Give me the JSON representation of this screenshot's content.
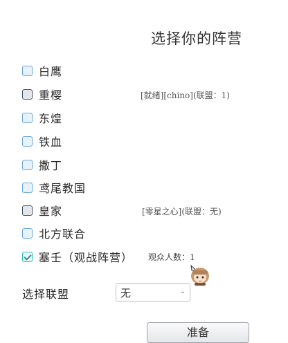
{
  "title": "选择你的阵营",
  "factions": [
    {
      "label": "白鹰",
      "info": "",
      "state": "unchecked"
    },
    {
      "label": "重樱",
      "info": "[就绪][chino](联盟：1)",
      "state": "unchecked-dark"
    },
    {
      "label": "东煌",
      "info": "",
      "state": "unchecked"
    },
    {
      "label": "铁血",
      "info": "",
      "state": "unchecked"
    },
    {
      "label": "撒丁",
      "info": "",
      "state": "unchecked"
    },
    {
      "label": "鸢尾教国",
      "info": "",
      "state": "unchecked"
    },
    {
      "label": "皇家",
      "info": "[零星之心](联盟：无)",
      "state": "unchecked-dark"
    },
    {
      "label": "北方联合",
      "info": "",
      "state": "unchecked"
    },
    {
      "label": "塞壬（观战阵营）",
      "info": "",
      "state": "checked"
    }
  ],
  "online_text": "观众人数：1",
  "alliance": {
    "label": "选择联盟",
    "selected": "无"
  },
  "confirm_label": "准备"
}
